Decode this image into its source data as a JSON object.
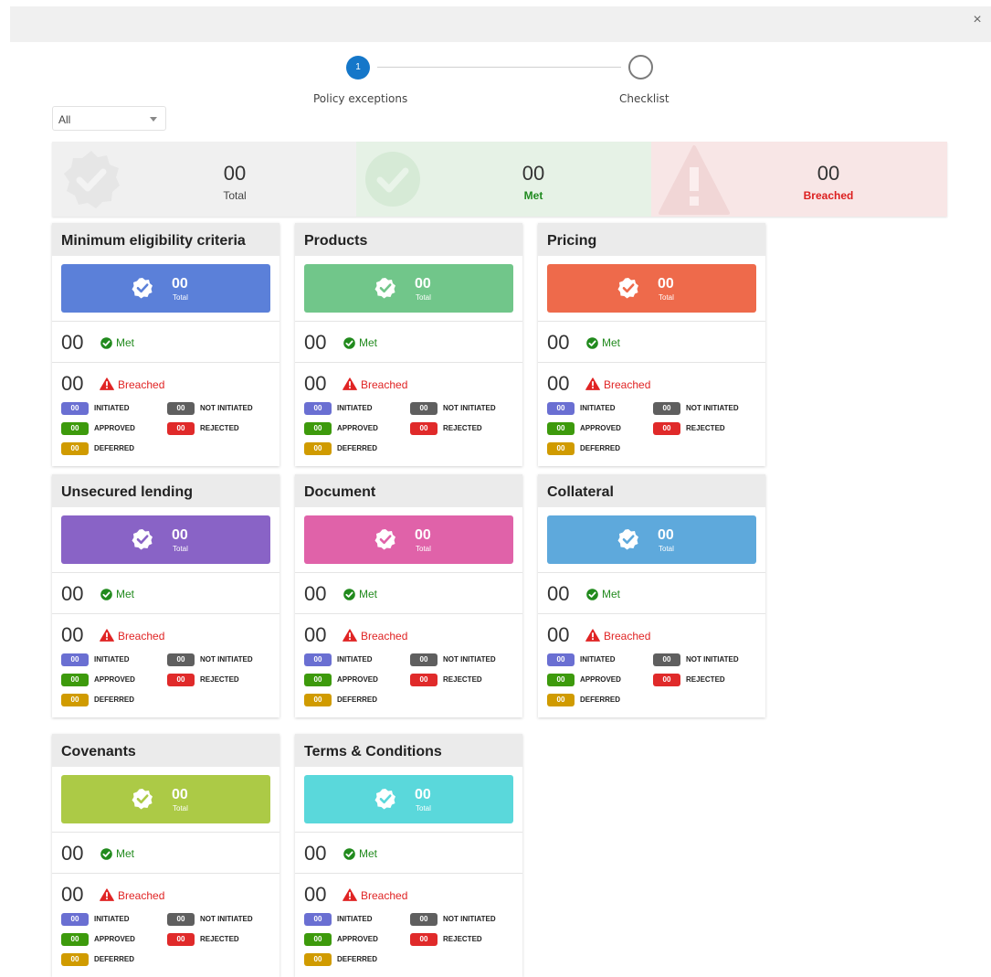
{
  "window": {
    "close_glyph": "×",
    "close_icon": "close-icon"
  },
  "stepper": {
    "steps": [
      {
        "number": "1",
        "label": "Policy exceptions",
        "active": true
      },
      {
        "number": "",
        "label": "Checklist",
        "active": false
      }
    ],
    "active_color": "#1577c9"
  },
  "filter": {
    "selected": "All",
    "icon": "chevron-down-icon"
  },
  "summary": {
    "total": {
      "value": "00",
      "label": "Total",
      "bg": "#f0f0f0",
      "icon": "badge-check-icon"
    },
    "met": {
      "value": "00",
      "label": "Met",
      "bg": "#e6f2e6",
      "label_color": "#1f8a1f",
      "icon": "check-circle-icon"
    },
    "breached": {
      "value": "00",
      "label": "Breached",
      "bg": "#f8e6e6",
      "label_color": "#dc1f1f",
      "icon": "warning-icon"
    }
  },
  "status_labels": {
    "met": "Met",
    "breached": "Breached",
    "banner_total": "Total",
    "initiated": "INITIATED",
    "not_initiated": "NOT INITIATED",
    "approved": "APPROVED",
    "rejected": "REJECTED",
    "deferred": "DEFERRED"
  },
  "status_colors": {
    "initiated": "#6a6fd2",
    "not_initiated": "#5f5f5f",
    "approved": "#3d9a0c",
    "rejected": "#e02a2a",
    "deferred": "#d09b00"
  },
  "cards": [
    {
      "title": "Minimum eligibility criteria",
      "color": "#5b80d9",
      "total": "00",
      "met": "00",
      "breached": "00",
      "initiated": "00",
      "not_initiated": "00",
      "approved": "00",
      "rejected": "00",
      "deferred": "00"
    },
    {
      "title": "Products",
      "color": "#71c68a",
      "total": "00",
      "met": "00",
      "breached": "00",
      "initiated": "00",
      "not_initiated": "00",
      "approved": "00",
      "rejected": "00",
      "deferred": "00"
    },
    {
      "title": "Pricing",
      "color": "#ee6a4b",
      "total": "00",
      "met": "00",
      "breached": "00",
      "initiated": "00",
      "not_initiated": "00",
      "approved": "00",
      "rejected": "00",
      "deferred": "00"
    },
    {
      "title": "Unsecured lending",
      "color": "#8963c6",
      "total": "00",
      "met": "00",
      "breached": "00",
      "initiated": "00",
      "not_initiated": "00",
      "approved": "00",
      "rejected": "00",
      "deferred": "00"
    },
    {
      "title": "Document",
      "color": "#e062a9",
      "total": "00",
      "met": "00",
      "breached": "00",
      "initiated": "00",
      "not_initiated": "00",
      "approved": "00",
      "rejected": "00",
      "deferred": "00"
    },
    {
      "title": "Collateral",
      "color": "#5ea9dc",
      "total": "00",
      "met": "00",
      "breached": "00",
      "initiated": "00",
      "not_initiated": "00",
      "approved": "00",
      "rejected": "00",
      "deferred": "00"
    },
    {
      "title": "Covenants",
      "color": "#acca46",
      "total": "00",
      "met": "00",
      "breached": "00",
      "initiated": "00",
      "not_initiated": "00",
      "approved": "00",
      "rejected": "00",
      "deferred": "00"
    },
    {
      "title": "Terms & Conditions",
      "color": "#5ad8db",
      "total": "00",
      "met": "00",
      "breached": "00",
      "initiated": "00",
      "not_initiated": "00",
      "approved": "00",
      "rejected": "00",
      "deferred": "00"
    }
  ]
}
